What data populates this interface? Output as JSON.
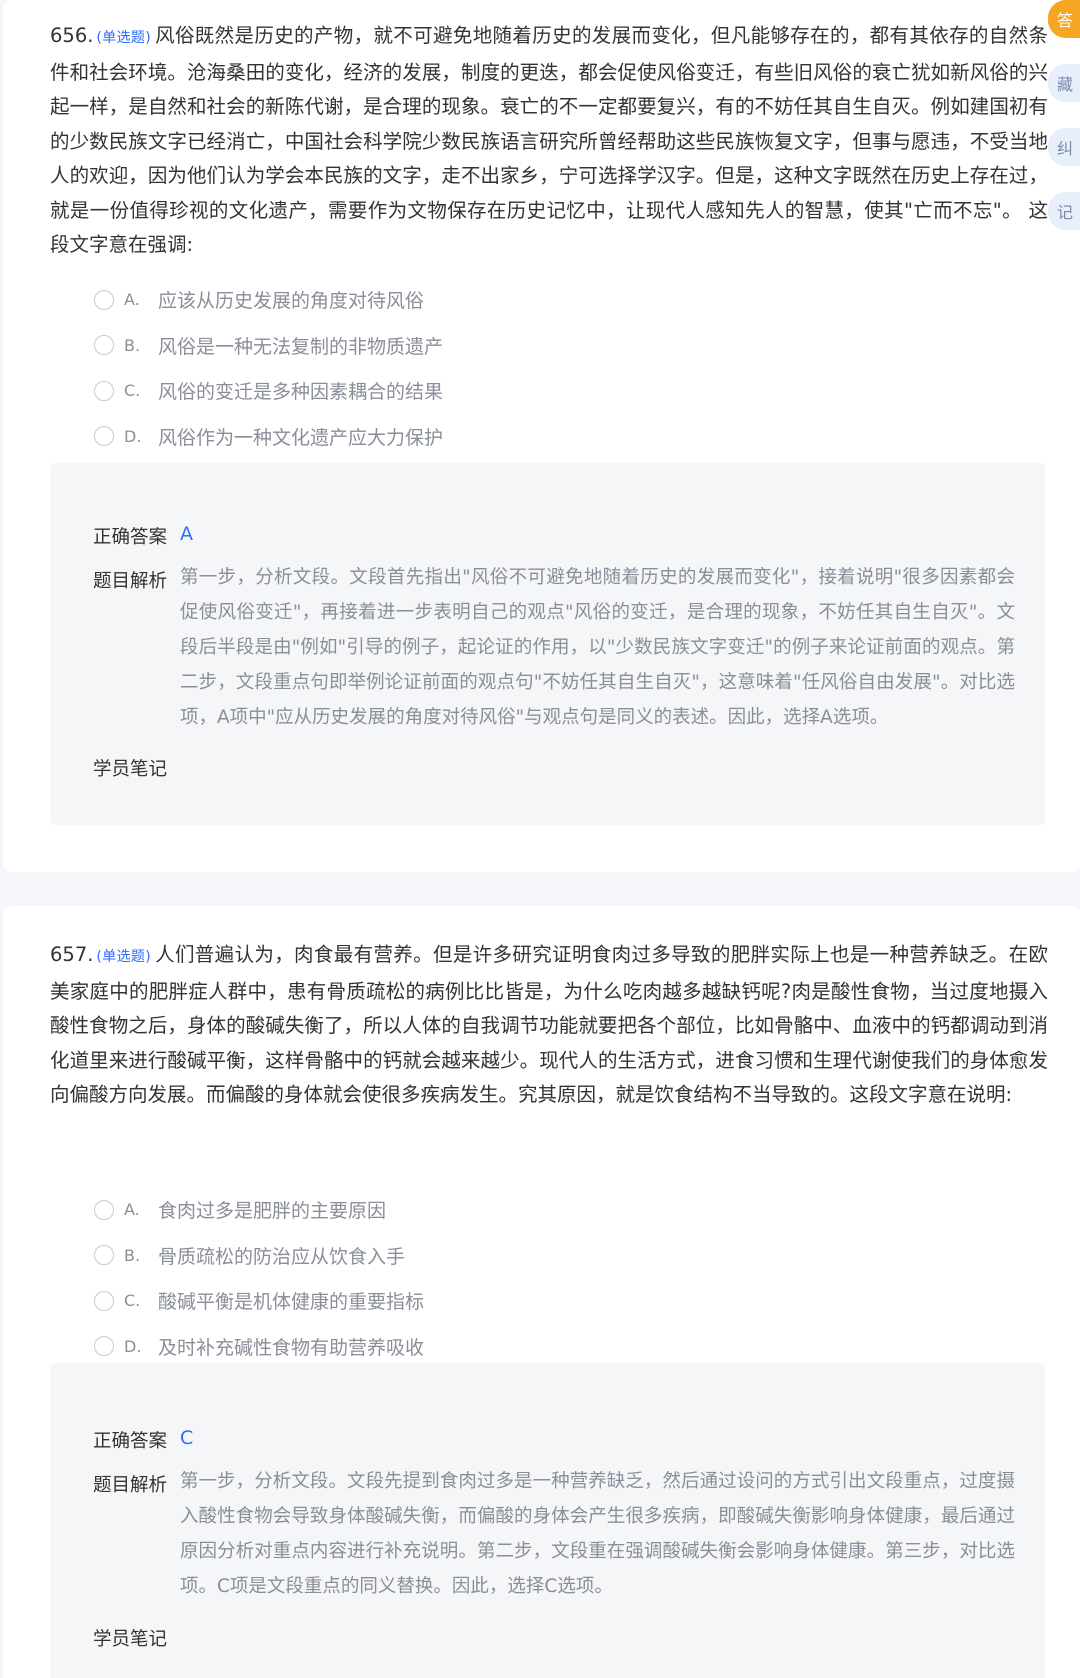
{
  "questions": [
    {
      "number": "656.",
      "type": "(单选题)",
      "stem": "风俗既然是历史的产物，就不可避免地随着历史的发展而变化，但凡能够存在的，都有其依存的自然条件和社会环境。沧海桑田的变化，经济的发展，制度的更迭，都会促使风俗变迁，有些旧风俗的衰亡犹如新风俗的兴起一样，是自然和社会的新陈代谢，是合理的现象。衰亡的不一定都要复兴，有的不妨任其自生自灭。例如建国初有的少数民族文字已经消亡，中国社会科学院少数民族语言研究所曾经帮助这些民族恢复文字，但事与愿违，不受当地人的欢迎，因为他们认为学会本民族的文字，走不出家乡，宁可选择学汉字。但是，这种文字既然在历史上存在过，就是一份值得珍视的文化遗产，需要作为文物保存在历史记忆中，让现代人感知先人的智慧，使其\"亡而不忘\"。 这段文字意在强调:",
      "options": [
        {
          "letter": "A.",
          "text": "应该从历史发展的角度对待风俗"
        },
        {
          "letter": "B.",
          "text": "风俗是一种无法复制的非物质遗产"
        },
        {
          "letter": "C.",
          "text": "风俗的变迁是多种因素耦合的结果"
        },
        {
          "letter": "D.",
          "text": "风俗作为一种文化遗产应大力保护"
        }
      ],
      "answer_label": "正确答案",
      "answer": "A",
      "analysis_label": "题目解析",
      "analysis": "第一步，分析文段。文段首先指出\"风俗不可避免地随着历史的发展而变化\"，接着说明\"很多因素都会促使风俗变迁\"，再接着进一步表明自己的观点\"风俗的变迁，是合理的现象，不妨任其自生自灭\"。文段后半段是由\"例如\"引导的例子，起论证的作用，以\"少数民族文字变迁\"的例子来论证前面的观点。第二步，文段重点句即举例论证前面的观点句\"不妨任其自生自灭\"，这意味着\"任风俗自由发展\"。对比选项，A项中\"应从历史发展的角度对待风俗\"与观点句是同义的表述。因此，选择A选项。",
      "notes_label": "学员笔记"
    },
    {
      "number": "657.",
      "type": "(单选题)",
      "stem": "人们普遍认为，肉食最有营养。但是许多研究证明食肉过多导致的肥胖实际上也是一种营养缺乏。在欧美家庭中的肥胖症人群中，患有骨质疏松的病例比比皆是，为什么吃肉越多越缺钙呢?肉是酸性食物，当过度地摄入酸性食物之后，身体的酸碱失衡了，所以人体的自我调节功能就要把各个部位，比如骨骼中、血液中的钙都调动到消化道里来进行酸碱平衡，这样骨骼中的钙就会越来越少。现代人的生活方式，进食习惯和生理代谢使我们的身体愈发向偏酸方向发展。而偏酸的身体就会使很多疾病发生。究其原因，就是饮食结构不当导致的。这段文字意在说明:",
      "options": [
        {
          "letter": "A.",
          "text": "食肉过多是肥胖的主要原因"
        },
        {
          "letter": "B.",
          "text": "骨质疏松的防治应从饮食入手"
        },
        {
          "letter": "C.",
          "text": "酸碱平衡是机体健康的重要指标"
        },
        {
          "letter": "D.",
          "text": "及时补充碱性食物有助营养吸收"
        }
      ],
      "answer_label": "正确答案",
      "answer": "C",
      "analysis_label": "题目解析",
      "analysis": "第一步，分析文段。文段先提到食肉过多是一种营养缺乏，然后通过设问的方式引出文段重点，过度摄入酸性食物会导致身体酸碱失衡，而偏酸的身体会产生很多疾病，即酸碱失衡影响身体健康，最后通过原因分析对重点内容进行补充说明。第二步，文段重在强调酸碱失衡会影响身体健康。第三步，对比选项。C项是文段重点的同义替换。因此，选择C选项。",
      "notes_label": "学员笔记"
    }
  ],
  "side_tools": {
    "answer": "答",
    "favorite": "藏",
    "correct": "纠",
    "note": "记"
  },
  "colors": {
    "accent_blue": "#2f6bff",
    "active_orange": "#f6a623",
    "muted_text": "#8a8e99"
  }
}
